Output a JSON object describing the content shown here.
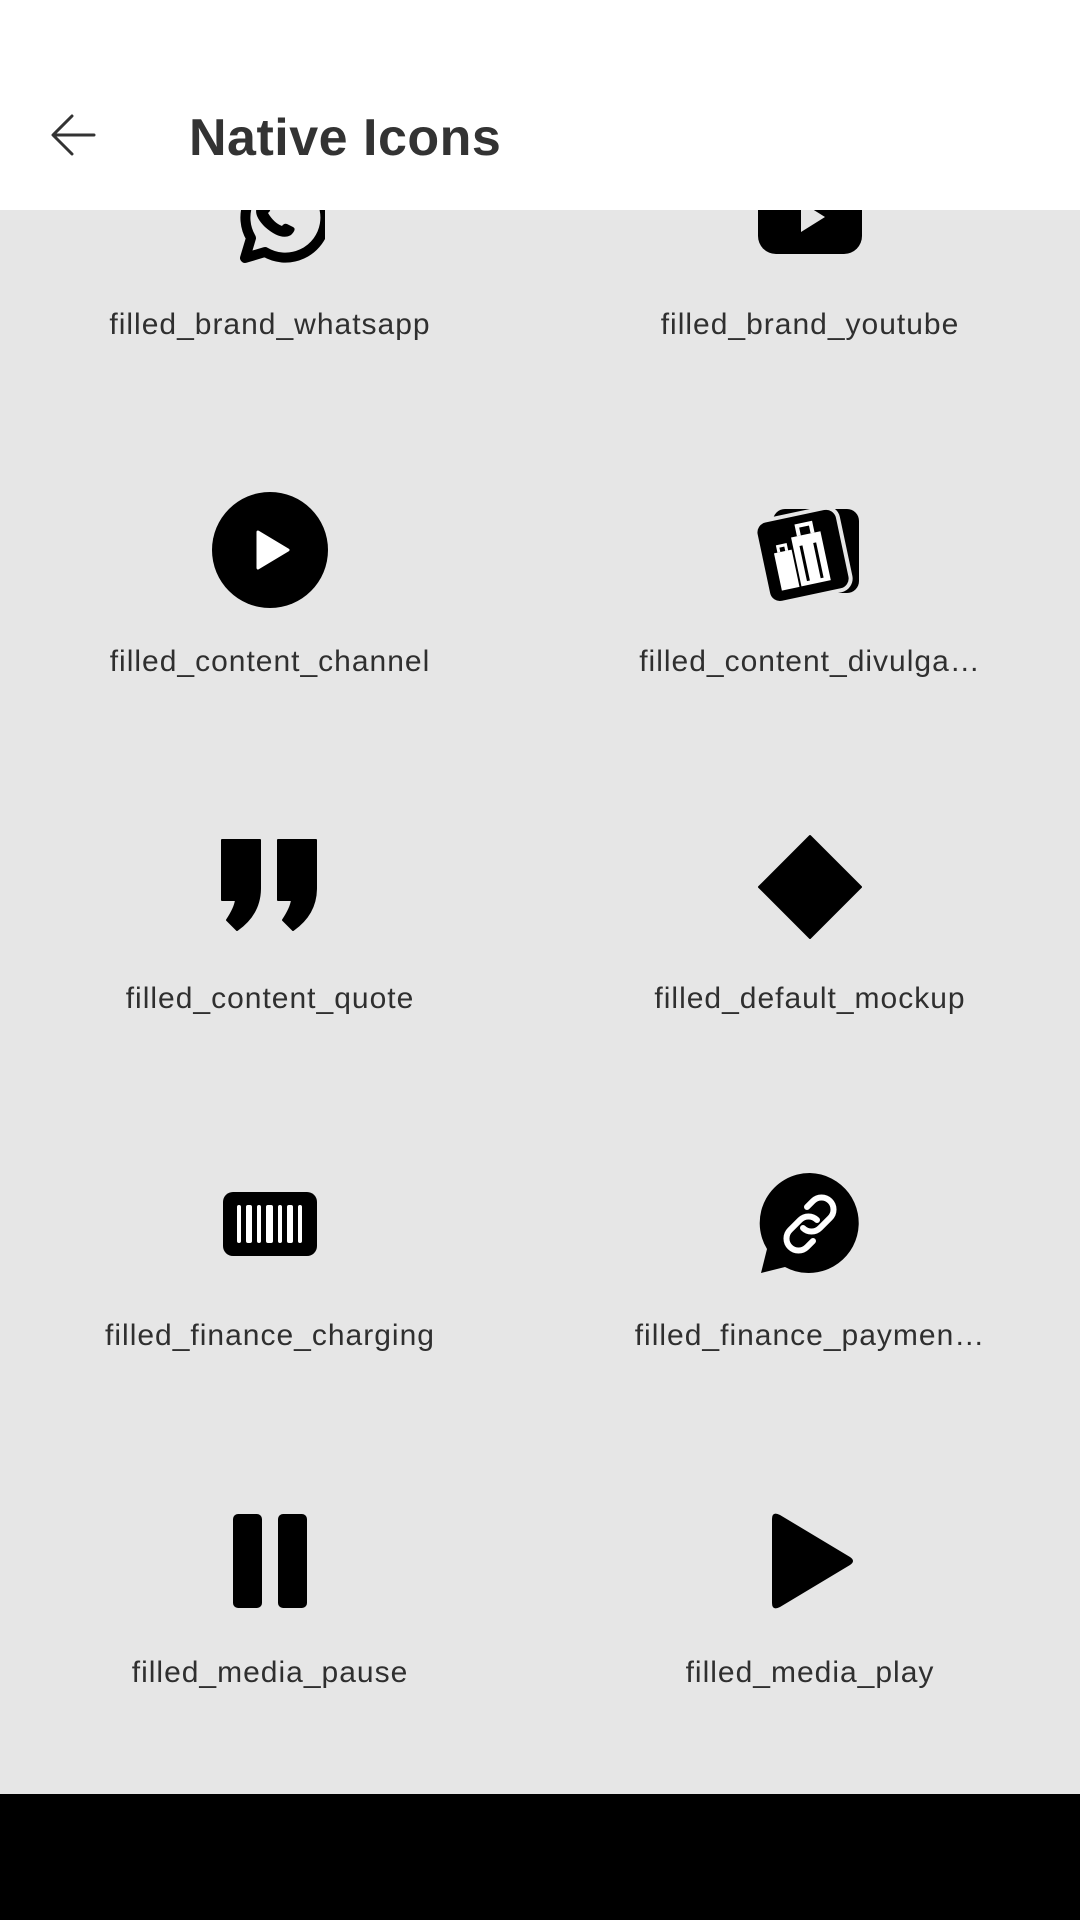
{
  "header": {
    "title": "Native Icons",
    "back_icon": "arrow-left-icon"
  },
  "icons": [
    {
      "label": "filled_brand_whatsapp",
      "icon": "whatsapp-icon"
    },
    {
      "label": "filled_brand_youtube",
      "icon": "youtube-icon"
    },
    {
      "label": "filled_content_channel",
      "icon": "play-circle-icon"
    },
    {
      "label": "filled_content_divulga…",
      "icon": "shopping-bags-icon"
    },
    {
      "label": "filled_content_quote",
      "icon": "quote-icon"
    },
    {
      "label": "filled_default_mockup",
      "icon": "diamond-icon"
    },
    {
      "label": "filled_finance_charging",
      "icon": "barcode-icon"
    },
    {
      "label": "filled_finance_paymen…",
      "icon": "link-chat-icon"
    },
    {
      "label": "filled_media_pause",
      "icon": "pause-icon"
    },
    {
      "label": "filled_media_play",
      "icon": "play-icon"
    }
  ],
  "colors": {
    "header_bg": "#ffffff",
    "content_bg": "#e6e6e6",
    "icon_fill": "#000000",
    "text": "#2f2f2f",
    "nav_bar": "#000000"
  }
}
